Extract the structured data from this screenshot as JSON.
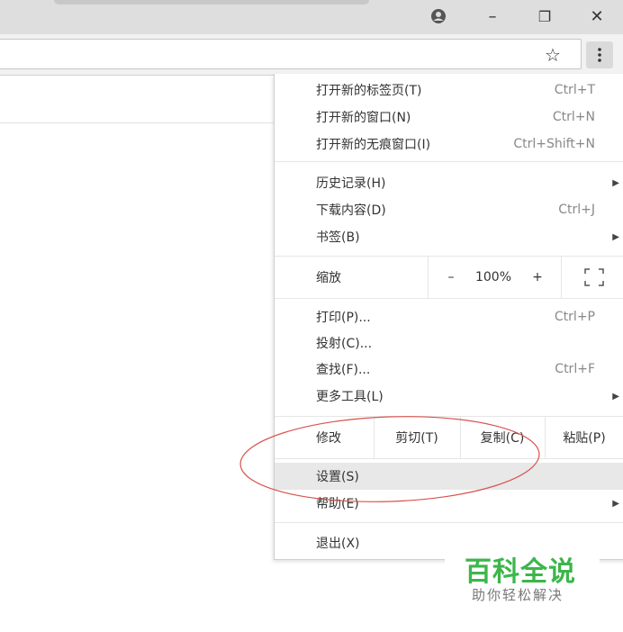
{
  "window": {
    "buttons": [
      {
        "name": "profile-icon",
        "glyph": "👤"
      },
      {
        "name": "minimize",
        "glyph": "–"
      },
      {
        "name": "restore",
        "glyph": "❐"
      },
      {
        "name": "close",
        "glyph": "✕"
      }
    ]
  },
  "toolbar": {
    "star_glyph": "☆",
    "menu_glyph": "⋮"
  },
  "menu": {
    "new_tab": {
      "label": "打开新的标签页(T)",
      "shortcut": "Ctrl+T"
    },
    "new_window": {
      "label": "打开新的窗口(N)",
      "shortcut": "Ctrl+N"
    },
    "incognito": {
      "label": "打开新的无痕窗口(I)",
      "shortcut": "Ctrl+Shift+N"
    },
    "history": {
      "label": "历史记录(H)",
      "arrow": "▶"
    },
    "downloads": {
      "label": "下载内容(D)",
      "shortcut": "Ctrl+J"
    },
    "bookmarks": {
      "label": "书签(B)",
      "arrow": "▶"
    },
    "zoom": {
      "label": "缩放",
      "minus": "–",
      "value": "100%",
      "plus": "+",
      "fullscreen": "⛶"
    },
    "print": {
      "label": "打印(P)...",
      "shortcut": "Ctrl+P"
    },
    "cast": {
      "label": "投射(C)..."
    },
    "find": {
      "label": "查找(F)...",
      "shortcut": "Ctrl+F"
    },
    "more_tools": {
      "label": "更多工具(L)",
      "arrow": "▶"
    },
    "edit": {
      "label": "修改",
      "cut": "剪切(T)",
      "copy": "复制(C)",
      "paste": "粘贴(P)"
    },
    "settings": {
      "label": "设置(S)"
    },
    "help": {
      "label": "帮助(E)",
      "arrow": "▶"
    },
    "exit": {
      "label": "退出(X)"
    }
  },
  "annotation": {
    "color": "#d9534f"
  },
  "watermark": {
    "title": "百科全说",
    "subtitle": "助你轻松解决",
    "color": "#3cb64a"
  }
}
